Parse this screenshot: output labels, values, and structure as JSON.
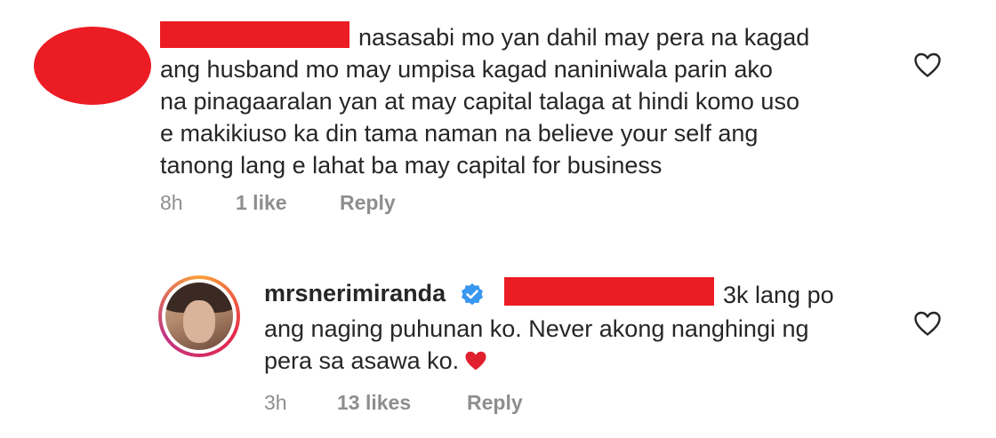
{
  "comments": [
    {
      "text_line1": "nasasabi mo yan dahil may pera na kagad",
      "text_lines": [
        "ang husband mo may umpisa kagad naniniwala parin ako",
        "na pinagaaralan yan at may capital talaga at hindi komo uso",
        "e makikiuso ka din tama naman na believe your self ang",
        "tanong lang e lahat ba may capital for business"
      ],
      "time": "8h",
      "likes": "1 like",
      "reply_label": "Reply"
    }
  ],
  "reply": {
    "username": "mrsnerimiranda",
    "text_line1": "3k lang po",
    "text_lines": [
      "ang naging puhunan ko. Never akong nanghingi ng",
      "pera sa asawa ko."
    ],
    "emoji": "red-heart",
    "time": "3h",
    "likes": "13 likes",
    "reply_label": "Reply"
  },
  "colors": {
    "redaction": "#ec1c24",
    "text": "#262626",
    "meta": "#8e8e8e",
    "verified": "#3897f0",
    "heart_emoji": "#e0202e"
  }
}
